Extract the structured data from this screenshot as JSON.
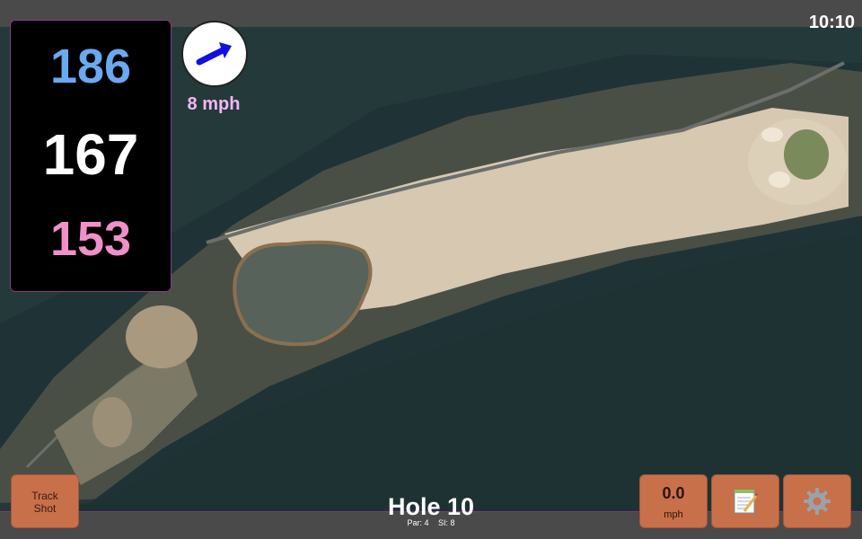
{
  "status_bar": {
    "time": "10:10"
  },
  "distances": {
    "back": "186",
    "middle": "167",
    "front": "153"
  },
  "wind": {
    "speed": "8 mph",
    "arrow_color": "#1010e0"
  },
  "hole": {
    "title": "Hole 10",
    "par": "Par: 4",
    "stroke_index": "SI: 8"
  },
  "buttons": {
    "track_line1": "Track",
    "track_line2": "Shot",
    "speed_value": "0.0",
    "speed_unit": "mph",
    "notes_icon": "notepad-icon",
    "settings_icon": "gear-icon"
  },
  "colors": {
    "back": "#6aaaf0",
    "middle": "#ffffff",
    "front": "#f090c8",
    "button": "#c8704a",
    "accent_border": "#8a3a8a"
  }
}
